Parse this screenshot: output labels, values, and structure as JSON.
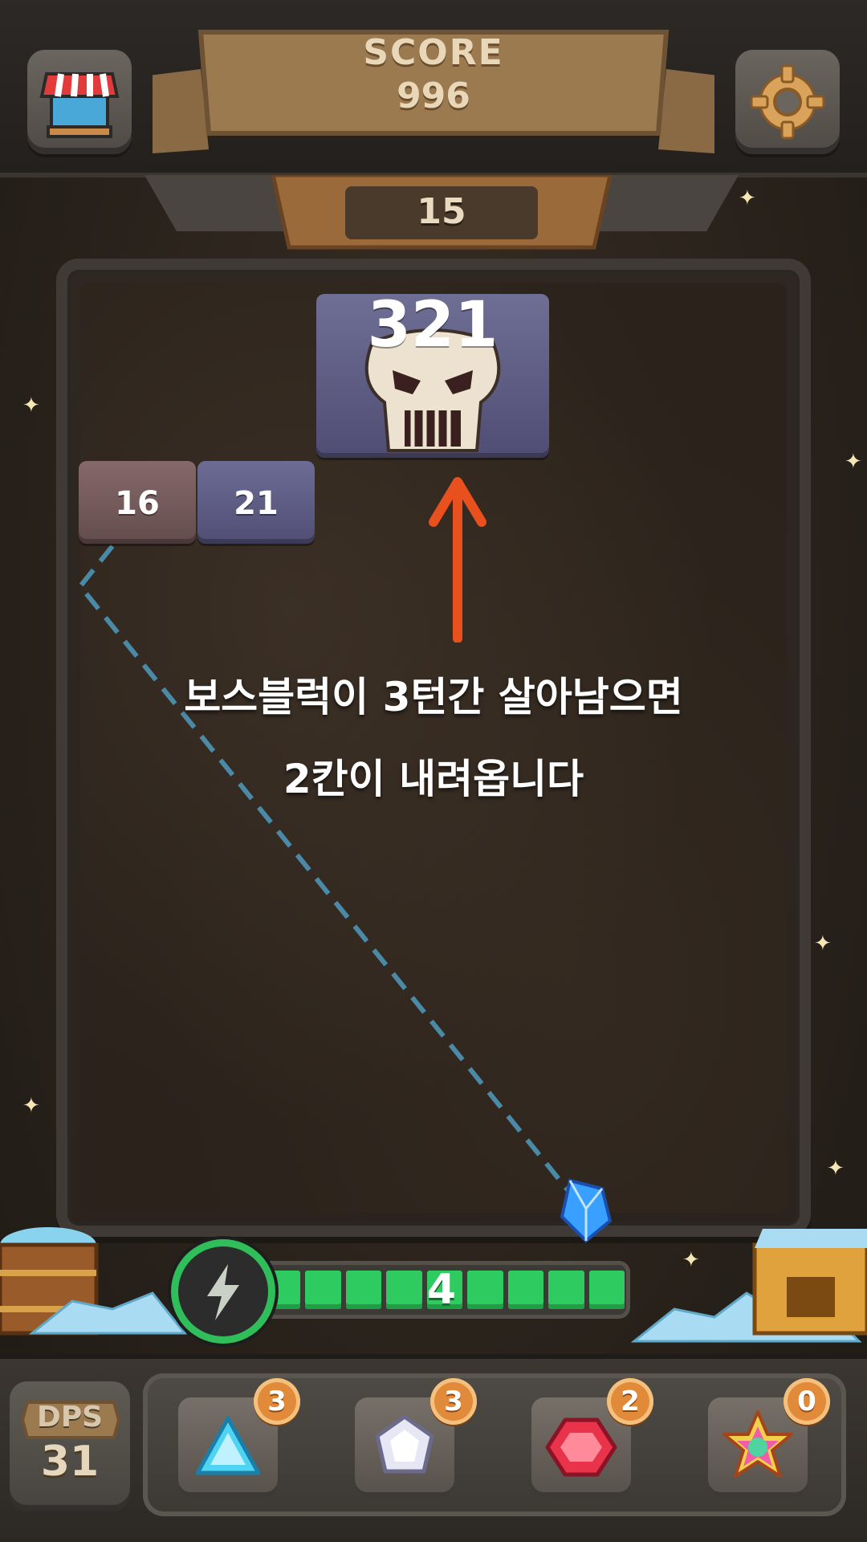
{
  "header": {
    "score_label": "SCORE",
    "score_value": "996",
    "turn_counter": "15",
    "shop_icon": "shop-stall-icon",
    "settings_icon": "gear-icon"
  },
  "board": {
    "boss_block": {
      "hp": "321",
      "icon": "skull-icon"
    },
    "blocks": [
      {
        "hp": "16"
      },
      {
        "hp": "21"
      }
    ],
    "hint_line1": "보스블럭이 3턴간 살아남으면",
    "hint_line2": "2칸이 내려옵니다",
    "arrow_color": "#e8501e",
    "aim_line_color": "#4a8aa6"
  },
  "power": {
    "value": "4",
    "icon": "lightning-icon",
    "segments_filled": 9,
    "bar_color": "#2ecc60"
  },
  "footer": {
    "dps_label": "DPS",
    "dps_value": "31",
    "gems": [
      {
        "icon": "cyan-triangle-gem-icon",
        "count": "3"
      },
      {
        "icon": "white-diamond-gem-icon",
        "count": "3"
      },
      {
        "icon": "red-hexagon-gem-icon",
        "count": "2"
      },
      {
        "icon": "rainbow-star-gem-icon",
        "count": "0"
      }
    ]
  }
}
